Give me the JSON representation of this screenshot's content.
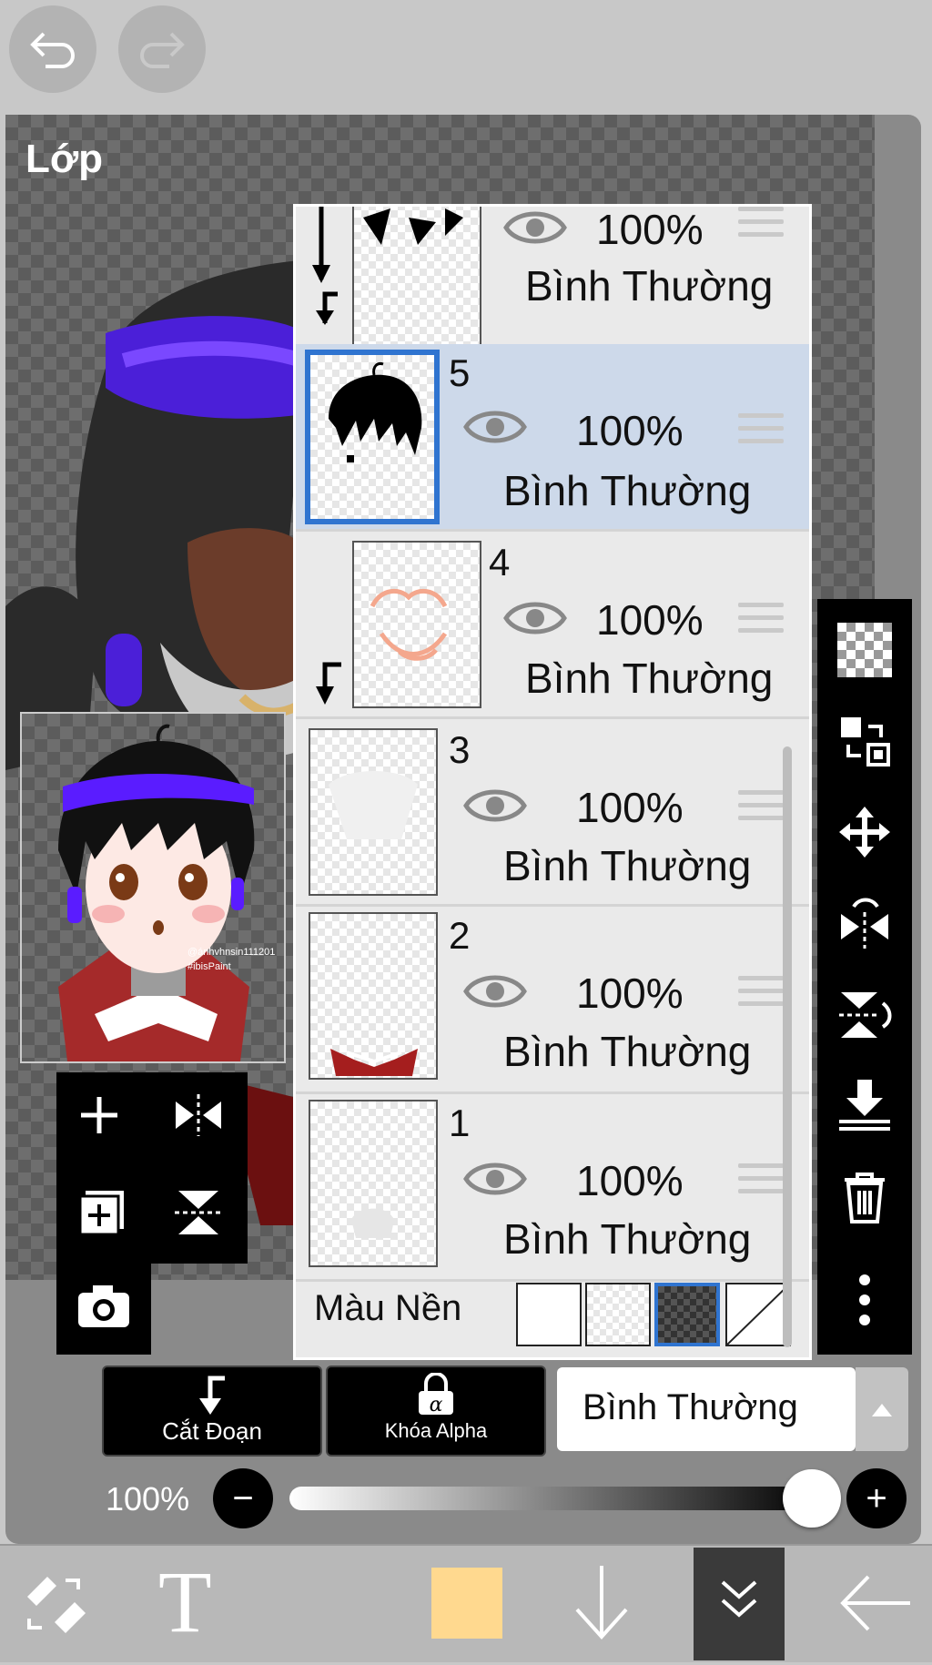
{
  "panel": {
    "title": "Lớp"
  },
  "layers": [
    {
      "id": "partial",
      "number": "",
      "opacity": "100%",
      "blend": "Bình Thường"
    },
    {
      "id": "5",
      "number": "5",
      "opacity": "100%",
      "blend": "Bình Thường",
      "selected": true
    },
    {
      "id": "4",
      "number": "4",
      "opacity": "100%",
      "blend": "Bình Thường"
    },
    {
      "id": "3",
      "number": "3",
      "opacity": "100%",
      "blend": "Bình Thường"
    },
    {
      "id": "2",
      "number": "2",
      "opacity": "100%",
      "blend": "Bình Thường"
    },
    {
      "id": "1",
      "number": "1",
      "opacity": "100%",
      "blend": "Bình Thường"
    }
  ],
  "background_color": {
    "label": "Màu Nền",
    "selected_index": 2
  },
  "buttons": {
    "clipping": "Cắt Đoạn",
    "alpha_lock": "Khóa Alpha",
    "blend_mode": "Bình Thường"
  },
  "opacity_slider": {
    "label": "100%",
    "value": 1.0
  },
  "preview": {
    "watermark_line1": "@ánhvhnsin111201",
    "watermark_line2": "#ibisPaint"
  },
  "colors": {
    "selected_layer": "#cdd9ea",
    "accent": "#2f74d0",
    "current_color": "#ffd98f",
    "hair_highlight": "#5a1cff"
  },
  "right_tools": [
    "transparent-icon",
    "swap-layer-icon",
    "move-icon",
    "flip-horizontal-icon",
    "flip-vertical-icon",
    "merge-down-icon",
    "trash-icon",
    "more-icon"
  ],
  "bottom_tools": [
    "eraser-tool-icon",
    "text-tool-icon",
    "color-swatch",
    "arrow-down-icon",
    "collapse-icon",
    "back-arrow-icon"
  ]
}
